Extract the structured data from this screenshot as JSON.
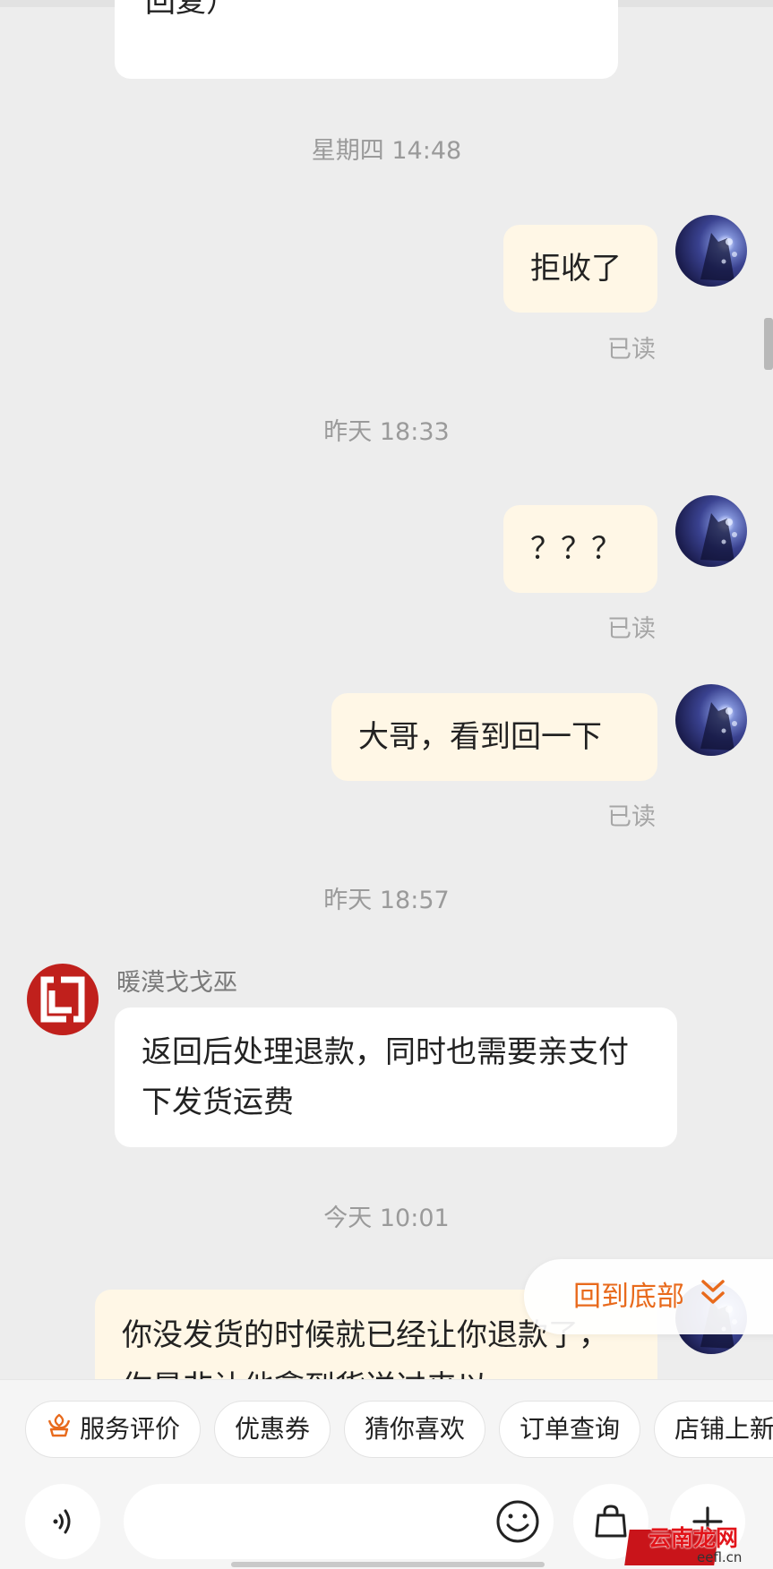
{
  "chat": {
    "prev_bubble_tail": "回复）",
    "timestamps": {
      "t1": "星期四 14:48",
      "t2": "昨天  18:33",
      "t3": "昨天  18:57",
      "t4": "今天  10:01"
    },
    "messages": {
      "m1": "拒收了",
      "m2": "？？？",
      "m3": "大哥，看到回一下",
      "m4_sender": "暖漠戈戈巫",
      "m4": "返回后处理退款，同时也需要亲支付下发货运费",
      "m5": "你没发货的时候就已经让你退款了，你是非让他拿到货送过来以"
    },
    "read_status": "已读",
    "back_to_bottom": "回到底部"
  },
  "quick_actions": {
    "service_review": "服务评价",
    "coupon": "优惠券",
    "guess_you_like": "猜你喜欢",
    "order_query": "订单查询",
    "shop_new": "店铺上新"
  },
  "input": {
    "placeholder": ""
  },
  "watermark": {
    "site": "云南龙网",
    "url": "eefl.cn"
  },
  "colors": {
    "accent": "#e86a1c",
    "bubble_out": "#fff7e6",
    "bubble_in": "#ffffff",
    "background": "#ededed",
    "shop_avatar": "#c0201c"
  }
}
